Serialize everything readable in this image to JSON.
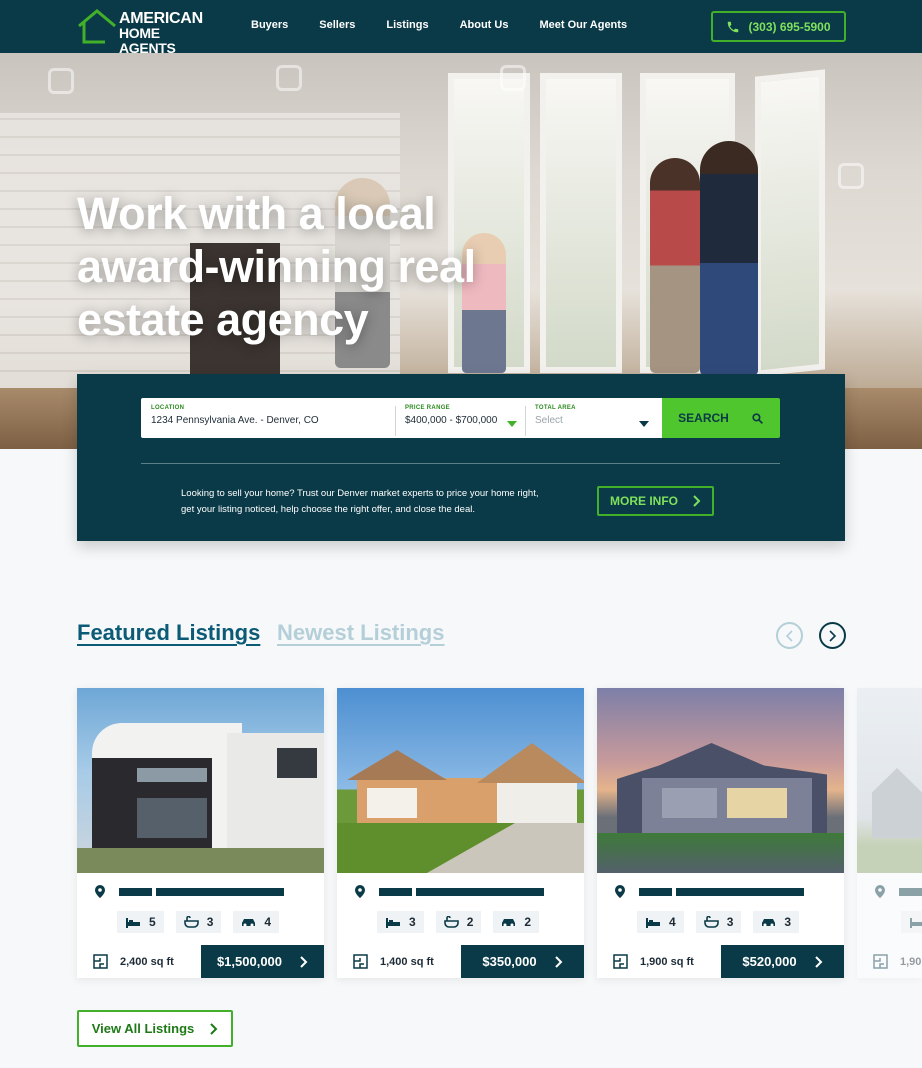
{
  "nav": {
    "logo_line1": "AMERICAN",
    "logo_line2": "HOME AGENTS",
    "links": [
      "Buyers",
      "Sellers",
      "Listings",
      "About Us",
      "Meet Our Agents"
    ],
    "phone": "(303) 695-5900"
  },
  "hero": {
    "title": "Work with a local award-winning real estate agency"
  },
  "search": {
    "location_label": "LOCATION",
    "location_value": "1234 Pennsylvania Ave. - Denver, CO",
    "price_label": "PRICE RANGE",
    "price_value": "$400,000 - $700,000",
    "area_label": "TOTAL AREA",
    "area_value": "Select",
    "button": "SEARCH",
    "sell_text": "Looking to sell your home? Trust our Denver market experts to price your home right, get your listing noticed, help choose the right offer, and close the deal.",
    "more_info": "MORE INFO"
  },
  "listings": {
    "tab_featured": "Featured Listings",
    "tab_newest": "Newest Listings",
    "cards": [
      {
        "beds": "5",
        "baths": "3",
        "garage": "4",
        "sqft": "2,400 sq ft",
        "price": "$1,500,000"
      },
      {
        "beds": "3",
        "baths": "2",
        "garage": "2",
        "sqft": "1,400 sq ft",
        "price": "$350,000"
      },
      {
        "beds": "4",
        "baths": "3",
        "garage": "3",
        "sqft": "1,900 sq ft",
        "price": "$520,000"
      },
      {
        "beds": "",
        "baths": "",
        "garage": "",
        "sqft": "1,90",
        "price": ""
      }
    ],
    "view_all": "View All Listings"
  },
  "colors": {
    "navy": "#0a3a47",
    "green": "#43b02a",
    "link_blue": "#0c5b76"
  }
}
